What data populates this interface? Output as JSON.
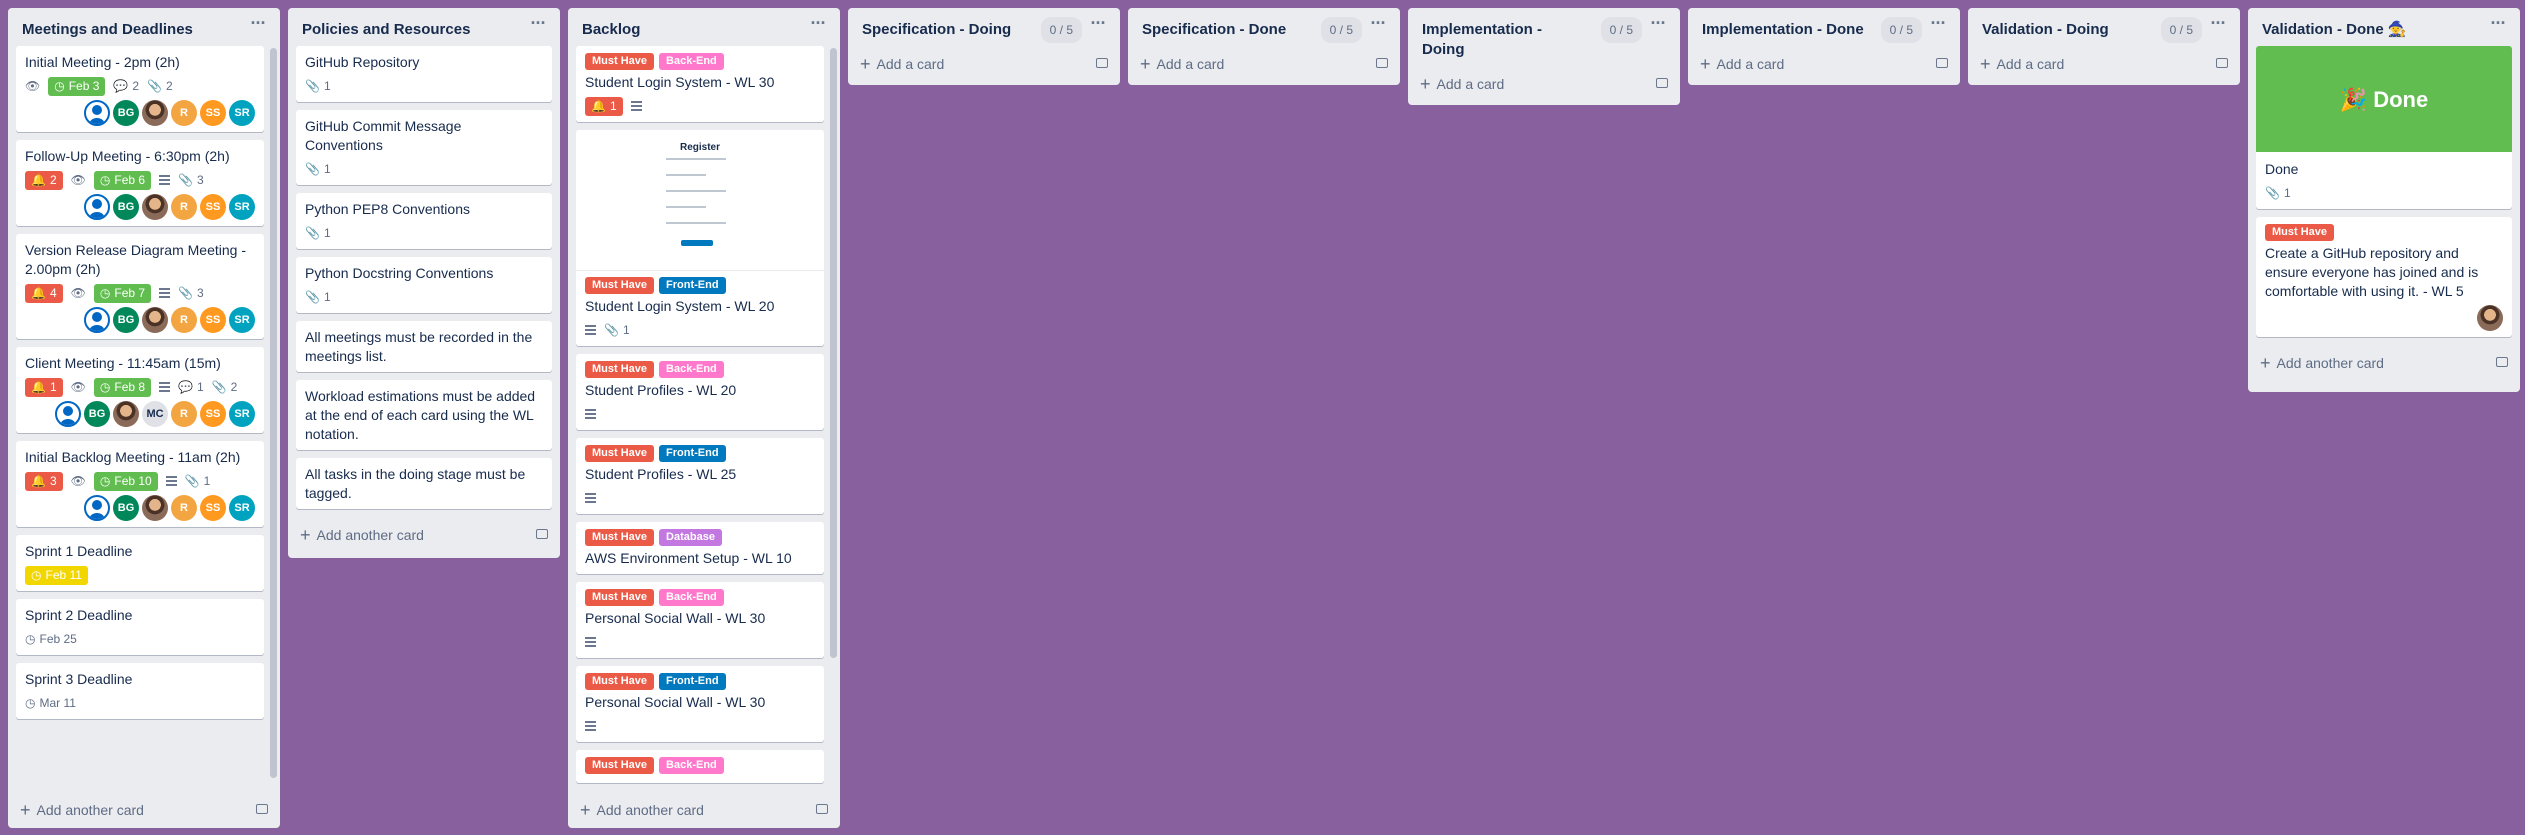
{
  "colors": {
    "board_bg": "#89609e",
    "list_bg": "#ebecf0",
    "must_have": "#eb5a46",
    "back_end": "#ff78cb",
    "front_end": "#0079bf",
    "database": "#c377e0",
    "due_green": "#61bd4f",
    "due_yellow": "#f2d600"
  },
  "lists": {
    "meetings": {
      "title": "Meetings and Deadlines",
      "add_label": "Add another card",
      "cards": [
        {
          "title": "Initial Meeting - 2pm (2h)",
          "due": "Feb 3",
          "comments": "2",
          "attachments": "2"
        },
        {
          "title": "Follow-Up Meeting - 6:30pm (2h)",
          "notifications": "2",
          "due": "Feb 6",
          "attachments": "3"
        },
        {
          "title": "Version Release Diagram Meeting - 2.00pm (2h)",
          "notifications": "4",
          "due": "Feb 7",
          "attachments": "3"
        },
        {
          "title": "Client Meeting - 11:45am (15m)",
          "notifications": "1",
          "due": "Feb 8",
          "comments": "1",
          "attachments": "2"
        },
        {
          "title": "Initial Backlog Meeting - 11am (2h)",
          "notifications": "3",
          "due": "Feb 10",
          "attachments": "1"
        },
        {
          "title": "Sprint 1 Deadline",
          "due": "Feb 11"
        },
        {
          "title": "Sprint 2 Deadline",
          "due": "Feb 25"
        },
        {
          "title": "Sprint 3 Deadline",
          "due": "Mar 11"
        }
      ],
      "members": {
        "bg": "BG",
        "r": "R",
        "ss": "SS",
        "sr": "SR",
        "mc": "MC"
      }
    },
    "policies": {
      "title": "Policies and Resources",
      "add_label": "Add another card",
      "cards": [
        {
          "title": "GitHub Repository",
          "attachments": "1"
        },
        {
          "title": "GitHub Commit Message Conventions",
          "attachments": "1"
        },
        {
          "title": "Python PEP8 Conventions",
          "attachments": "1"
        },
        {
          "title": "Python Docstring Conventions",
          "attachments": "1"
        },
        {
          "title": "All meetings must be recorded in the meetings list."
        },
        {
          "title": "Workload estimations must be added at the end of each card using the WL notation."
        },
        {
          "title": "All tasks in the doing stage must be tagged."
        }
      ]
    },
    "backlog": {
      "title": "Backlog",
      "add_label": "Add another card",
      "labels": {
        "must": "Must Have",
        "back": "Back-End",
        "front": "Front-End",
        "db": "Database"
      },
      "register_title": "Register",
      "cards": [
        {
          "title": "Student Login System - WL 30",
          "notifications": "1"
        },
        {
          "title": "Student Login System - WL 20",
          "attachments": "1"
        },
        {
          "title": "Student Profiles - WL 20"
        },
        {
          "title": "Student Profiles - WL 25"
        },
        {
          "title": "AWS Environment Setup - WL 10"
        },
        {
          "title": "Personal Social Wall - WL 30"
        },
        {
          "title": "Personal Social Wall - WL 30"
        }
      ]
    },
    "spec_doing": {
      "title": "Specification - Doing",
      "count": "0 / 5",
      "add_label": "Add a card"
    },
    "spec_done": {
      "title": "Specification - Done",
      "count": "0 / 5",
      "add_label": "Add a card"
    },
    "impl_doing": {
      "title": "Implementation - Doing",
      "count": "0 / 5",
      "add_label": "Add a card"
    },
    "impl_done": {
      "title": "Implementation - Done",
      "count": "0 / 5",
      "add_label": "Add a card"
    },
    "val_doing": {
      "title": "Validation - Doing",
      "count": "0 / 5",
      "add_label": "Add a card"
    },
    "val_done": {
      "title": "Validation - Done 🧙",
      "add_label": "Add another card",
      "cover_text": "Done",
      "cover_emoji": "🎉",
      "cards": [
        {
          "title": "Done",
          "attachments": "1"
        },
        {
          "title": "Create a GitHub repository and ensure everyone has joined and is comfortable with using it. - WL 5",
          "label": "Must Have"
        }
      ]
    }
  }
}
